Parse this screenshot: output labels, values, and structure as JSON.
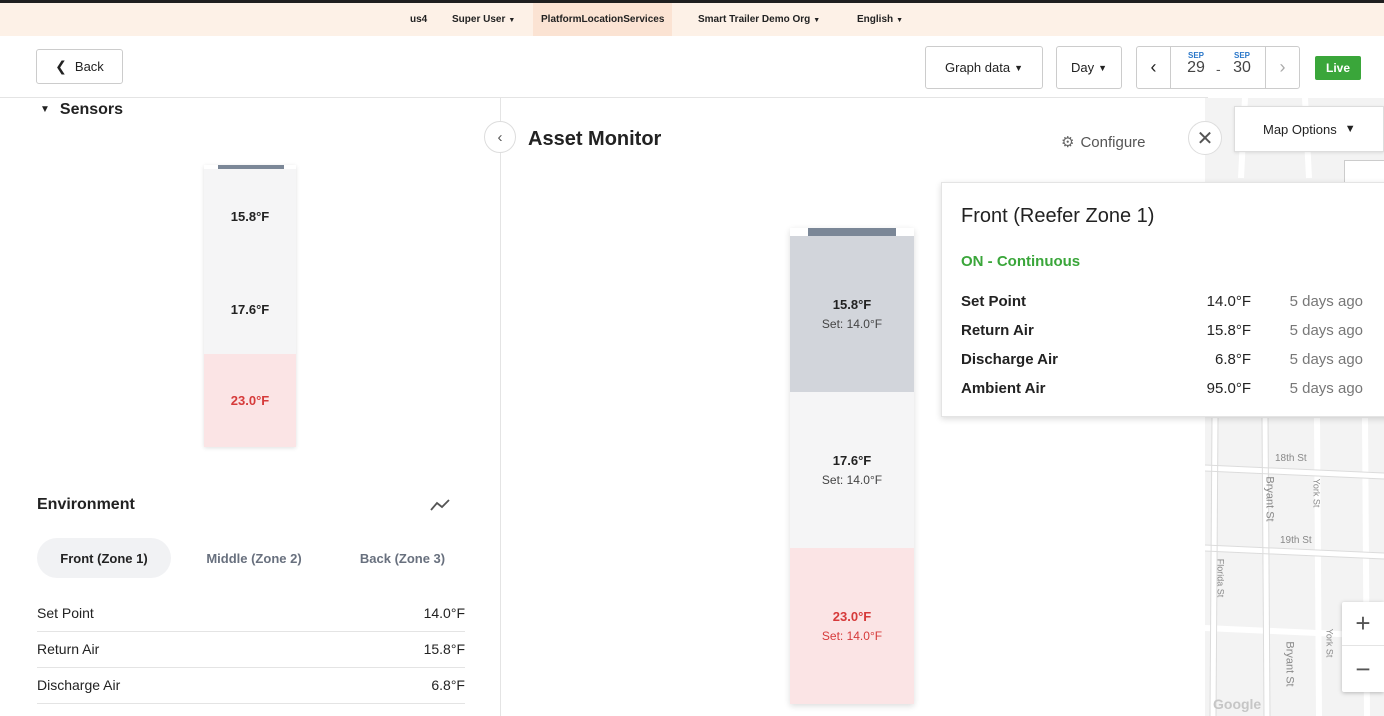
{
  "topbar": {
    "region": "us4",
    "user": "Super User",
    "service": "PlatformLocationServices",
    "org": "Smart Trailer Demo Org",
    "language": "English"
  },
  "toolbar": {
    "back_label": "Back",
    "graph_data_label": "Graph data",
    "period_label": "Day",
    "date_start_month": "SEP",
    "date_start_day": "29",
    "date_end_month": "SEP",
    "date_end_day": "30",
    "live_label": "Live"
  },
  "sensors": {
    "title": "Sensors",
    "mini_zones": [
      "15.8°F",
      "17.6°F",
      "23.0°F"
    ]
  },
  "environment": {
    "title": "Environment",
    "tabs": [
      "Front (Zone 1)",
      "Middle (Zone 2)",
      "Back (Zone 3)"
    ],
    "active_tab": "Front (Zone 1)",
    "rows": [
      {
        "label": "Set Point",
        "value": "14.0°F"
      },
      {
        "label": "Return Air",
        "value": "15.8°F"
      },
      {
        "label": "Discharge Air",
        "value": "6.8°F"
      }
    ]
  },
  "asset_monitor": {
    "title": "Asset Monitor",
    "configure_label": "Configure",
    "zones": [
      {
        "temp": "15.8°F",
        "set": "Set: 14.0°F"
      },
      {
        "temp": "17.6°F",
        "set": "Set: 14.0°F"
      },
      {
        "temp": "23.0°F",
        "set": "Set: 14.0°F"
      }
    ]
  },
  "map": {
    "options_label": "Map Options",
    "streets": [
      "18th St",
      "Bryant St",
      "York St",
      "19th St",
      "Florida St",
      "York St",
      "Bryant St"
    ],
    "attribution": "Google"
  },
  "popup": {
    "title": "Front (Reefer Zone 1)",
    "status": "ON - Continuous",
    "rows": [
      {
        "label": "Set Point",
        "value": "14.0°F",
        "time": "5 days ago"
      },
      {
        "label": "Return Air",
        "value": "15.8°F",
        "time": "5 days ago"
      },
      {
        "label": "Discharge Air",
        "value": "6.8°F",
        "time": "5 days ago"
      },
      {
        "label": "Ambient Air",
        "value": "95.0°F",
        "time": "5 days ago"
      }
    ]
  },
  "colors": {
    "live_green": "#3aa63a",
    "alert_red": "#d63a3a",
    "date_blue": "#2a77c9",
    "topbar_bg": "#fdf1e7"
  }
}
